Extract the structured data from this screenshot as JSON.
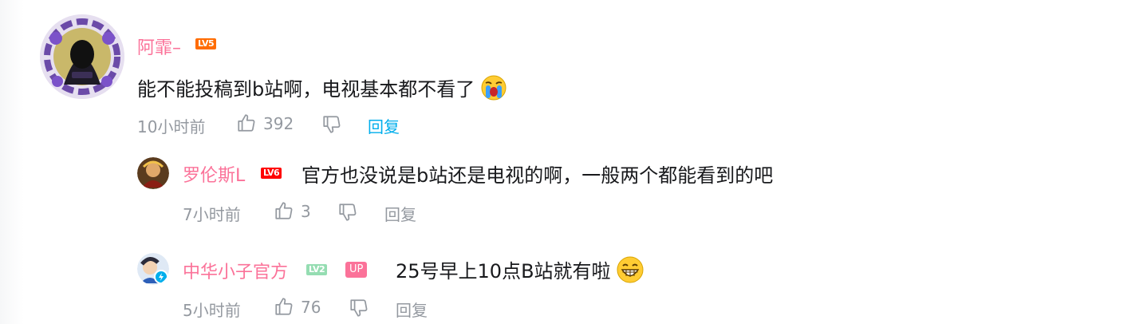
{
  "comments": [
    {
      "username": "阿霏–",
      "level": "LV5",
      "level_color": "#ff6c00",
      "text": "能不能投稿到b站啊，电视基本都不看了",
      "emoji": "cry-emoji",
      "time": "10小时前",
      "likes": "392",
      "reply_label": "回复",
      "reply_color": "#00aeec"
    },
    {
      "username": "罗伦斯L",
      "level": "LV6",
      "level_color": "#ff0000",
      "text": "官方也没说是b站还是电视的啊，一般两个都能看到的吧",
      "time": "7小时前",
      "likes": "3",
      "reply_label": "回复"
    },
    {
      "username": "中华小子官方",
      "level": "LV2",
      "level_color": "#95ddb2",
      "badge": "UP",
      "text": "25号早上10点B站就有啦",
      "emoji": "grin-emoji",
      "time": "5小时前",
      "likes": "76",
      "reply_label": "回复"
    }
  ]
}
